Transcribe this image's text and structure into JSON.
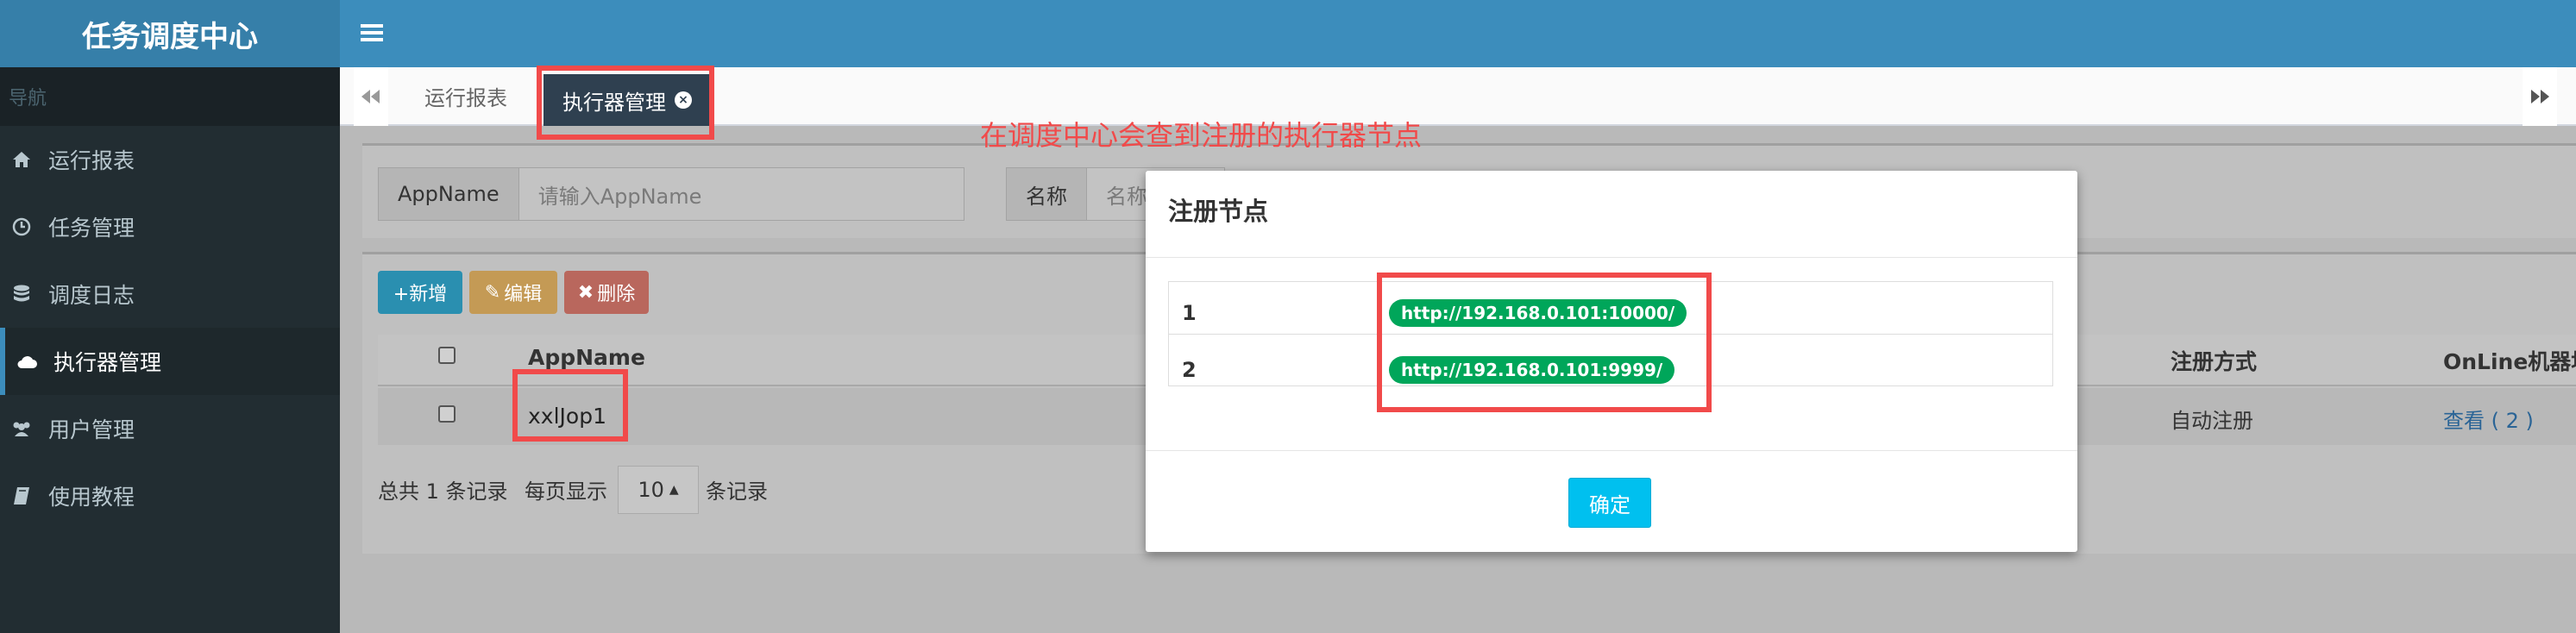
{
  "app": {
    "title": "任务调度中心"
  },
  "sidebar": {
    "nav_header": "导航",
    "items": [
      {
        "label": "运行报表",
        "icon": "home-icon"
      },
      {
        "label": "任务管理",
        "icon": "clock-icon"
      },
      {
        "label": "调度日志",
        "icon": "database-icon"
      },
      {
        "label": "执行器管理",
        "icon": "cloud-icon",
        "active": true
      },
      {
        "label": "用户管理",
        "icon": "users-icon"
      },
      {
        "label": "使用教程",
        "icon": "book-icon"
      }
    ]
  },
  "tabs": [
    {
      "label": "运行报表"
    },
    {
      "label": "执行器管理",
      "active": true
    }
  ],
  "search": {
    "appname_label": "AppName",
    "appname_placeholder": "请输入AppName",
    "name_label": "名称",
    "name_placeholder": "名称"
  },
  "toolbar": {
    "add_label": "+新增",
    "edit_label": "编辑",
    "delete_label": "删除"
  },
  "table": {
    "columns": [
      "AppName",
      "注册方式",
      "OnLine机器地"
    ],
    "rows": [
      {
        "appname": "xxlJop1",
        "register_type": "自动注册",
        "online": "查看 ( 2 )"
      }
    ]
  },
  "pagination": {
    "total_text": "总共 1 条记录",
    "per_page_label": "每页显示",
    "per_page_value": "10",
    "records_label": "条记录"
  },
  "modal": {
    "title": "注册节点",
    "nodes": [
      {
        "index": "1",
        "address": "http://192.168.0.101:10000/"
      },
      {
        "index": "2",
        "address": "http://192.168.0.101:9999/"
      }
    ],
    "ok_label": "确定"
  },
  "annotation": {
    "text": "在调度中心会查到注册的执行器节点"
  },
  "colors": {
    "header_blue": "#3c8dbc",
    "sidebar_dark": "#222d32",
    "badge_green": "#00a65a",
    "annotation_red": "#f14a4a",
    "ok_cyan": "#00c0ef"
  }
}
